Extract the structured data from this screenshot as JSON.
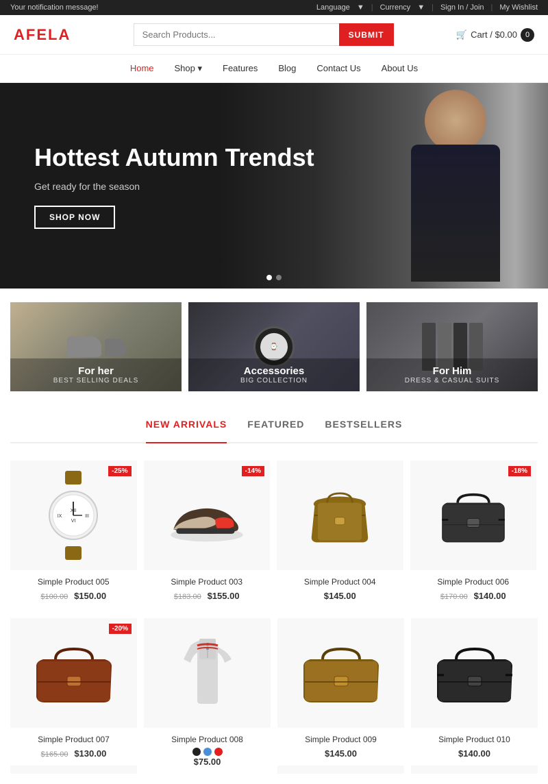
{
  "topbar": {
    "notification": "Your notification message!",
    "language_label": "Language",
    "currency_label": "Currency",
    "signin_label": "Sign In / Join",
    "wishlist_label": "My Wishlist"
  },
  "header": {
    "logo_prefix": "A",
    "logo_suffix": "FELA",
    "search_placeholder": "Search Products...",
    "search_btn": "SUBMIT",
    "cart_label": "Cart / $0.00",
    "cart_count": "0"
  },
  "nav": {
    "items": [
      {
        "label": "Home",
        "active": true
      },
      {
        "label": "Shop",
        "has_dropdown": true
      },
      {
        "label": "Features"
      },
      {
        "label": "Blog"
      },
      {
        "label": "Contact Us"
      },
      {
        "label": "About Us"
      }
    ]
  },
  "hero": {
    "headline": "Hottest Autumn Trendst",
    "subtext": "Get ready for the season",
    "cta": "SHOP NOW",
    "dots": 2,
    "active_dot": 0
  },
  "categories": [
    {
      "title": "For her",
      "subtitle": "BEST SELLING DEALS"
    },
    {
      "title": "Accessories",
      "subtitle": "BIG COLLECTION"
    },
    {
      "title": "For Him",
      "subtitle": "DRESS & CASUAL SUITS"
    }
  ],
  "tabs": [
    {
      "label": "NEW ARRIVALS",
      "active": true
    },
    {
      "label": "FEATURED"
    },
    {
      "label": "BESTSELLERS"
    }
  ],
  "products_row1": [
    {
      "name": "Simple Product 005",
      "price": "$150.00",
      "old_price": "$100.00",
      "discount": "-25%",
      "type": "watch"
    },
    {
      "name": "Simple Product 003",
      "price": "$155.00",
      "old_price": "$183.00",
      "discount": "-14%",
      "type": "shoe"
    },
    {
      "name": "Simple Product 004",
      "price": "$145.00",
      "old_price": null,
      "discount": null,
      "type": "bag-brown"
    },
    {
      "name": "Simple Product 006",
      "price": "$140.00",
      "old_price": "$170.00",
      "discount": "-18%",
      "type": "bag-black"
    }
  ],
  "products_row2": [
    {
      "name": "Simple Product 007",
      "price": "$130.00",
      "old_price": "$165.00",
      "discount": "-20%",
      "type": "leather-bag"
    },
    {
      "name": "Simple Product 008",
      "price": "$75.00",
      "old_price": null,
      "discount": null,
      "type": "polo",
      "colors": [
        "#222",
        "#4a90d9",
        "#e02020"
      ]
    },
    {
      "name": "Simple Product 009",
      "price": "$145.00",
      "old_price": null,
      "discount": null,
      "type": "bag-brown2"
    },
    {
      "name": "Simple Product 010",
      "price": "$140.00",
      "old_price": null,
      "discount": null,
      "type": "bag-black2"
    }
  ]
}
